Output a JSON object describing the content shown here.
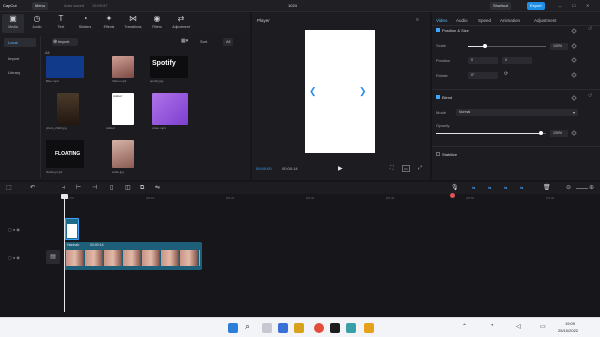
{
  "app": {
    "logo": "CapCut",
    "menu_label": "Menu",
    "project_label": "Auto saved",
    "project_time": "19:09:57",
    "title": "1024",
    "shortcut_label": "Shortcut",
    "export_label": "Export"
  },
  "toolbar": {
    "items": [
      {
        "label": "Media",
        "icon": "media-icon"
      },
      {
        "label": "Audio",
        "icon": "audio-icon"
      },
      {
        "label": "Text",
        "icon": "text-icon"
      },
      {
        "label": "Stickers",
        "icon": "stickers-icon"
      },
      {
        "label": "Effects",
        "icon": "effects-icon"
      },
      {
        "label": "Transitions",
        "icon": "transitions-icon"
      },
      {
        "label": "Filters",
        "icon": "filters-icon"
      },
      {
        "label": "Adjustment",
        "icon": "adjustment-icon"
      }
    ]
  },
  "media": {
    "sidebar": [
      "Local",
      "Import",
      "Library"
    ],
    "import_label": "Import",
    "sort_label": "Sort",
    "all_label": "All",
    "section_label": "All",
    "items": [
      {
        "caption": "Blue.mp4",
        "overlay": ""
      },
      {
        "caption": "Video.mp4",
        "overlay": ""
      },
      {
        "caption": "spotify.jpg",
        "overlay": "Spotify"
      },
      {
        "caption": "photo_2022.jpg",
        "overlay": ""
      },
      {
        "caption": "Added",
        "overlay": "Added"
      },
      {
        "caption": "video.mp4",
        "overlay": ""
      },
      {
        "caption": "floating.mp4",
        "overlay": "FLOATING"
      },
      {
        "caption": "selfie.jpg",
        "overlay": ""
      }
    ]
  },
  "player": {
    "label": "Player",
    "time_current": "00:00:00",
    "time_total": "00:00:14"
  },
  "properties": {
    "tabs": [
      "Video",
      "Audio",
      "Speed",
      "Animation",
      "Adjustment"
    ],
    "section_position": "Position & Size",
    "scale_label": "Scale",
    "scale_value": "100%",
    "position_label": "Position",
    "pos_x": "0",
    "pos_y": "0",
    "rotate_label": "Rotate",
    "rotate_value": "0°",
    "section_blend": "Blend",
    "mode_label": "Mode",
    "mode_value": "Normal",
    "opacity_label": "Opacity",
    "opacity_value": "100%",
    "section_stabilize": "Stabilize",
    "scale_fraction": 0.22,
    "opacity_fraction": 0.95
  },
  "timeline": {
    "ruler": [
      "00:00",
      "|00:10",
      "|00:20",
      "|00:30",
      "|00:40",
      "|00:50",
      "|01:00"
    ],
    "clip_label": "Hannah",
    "clip_duration": "00:00:14"
  },
  "taskbar": {
    "time": "19:09",
    "date": "25/10/2022"
  }
}
